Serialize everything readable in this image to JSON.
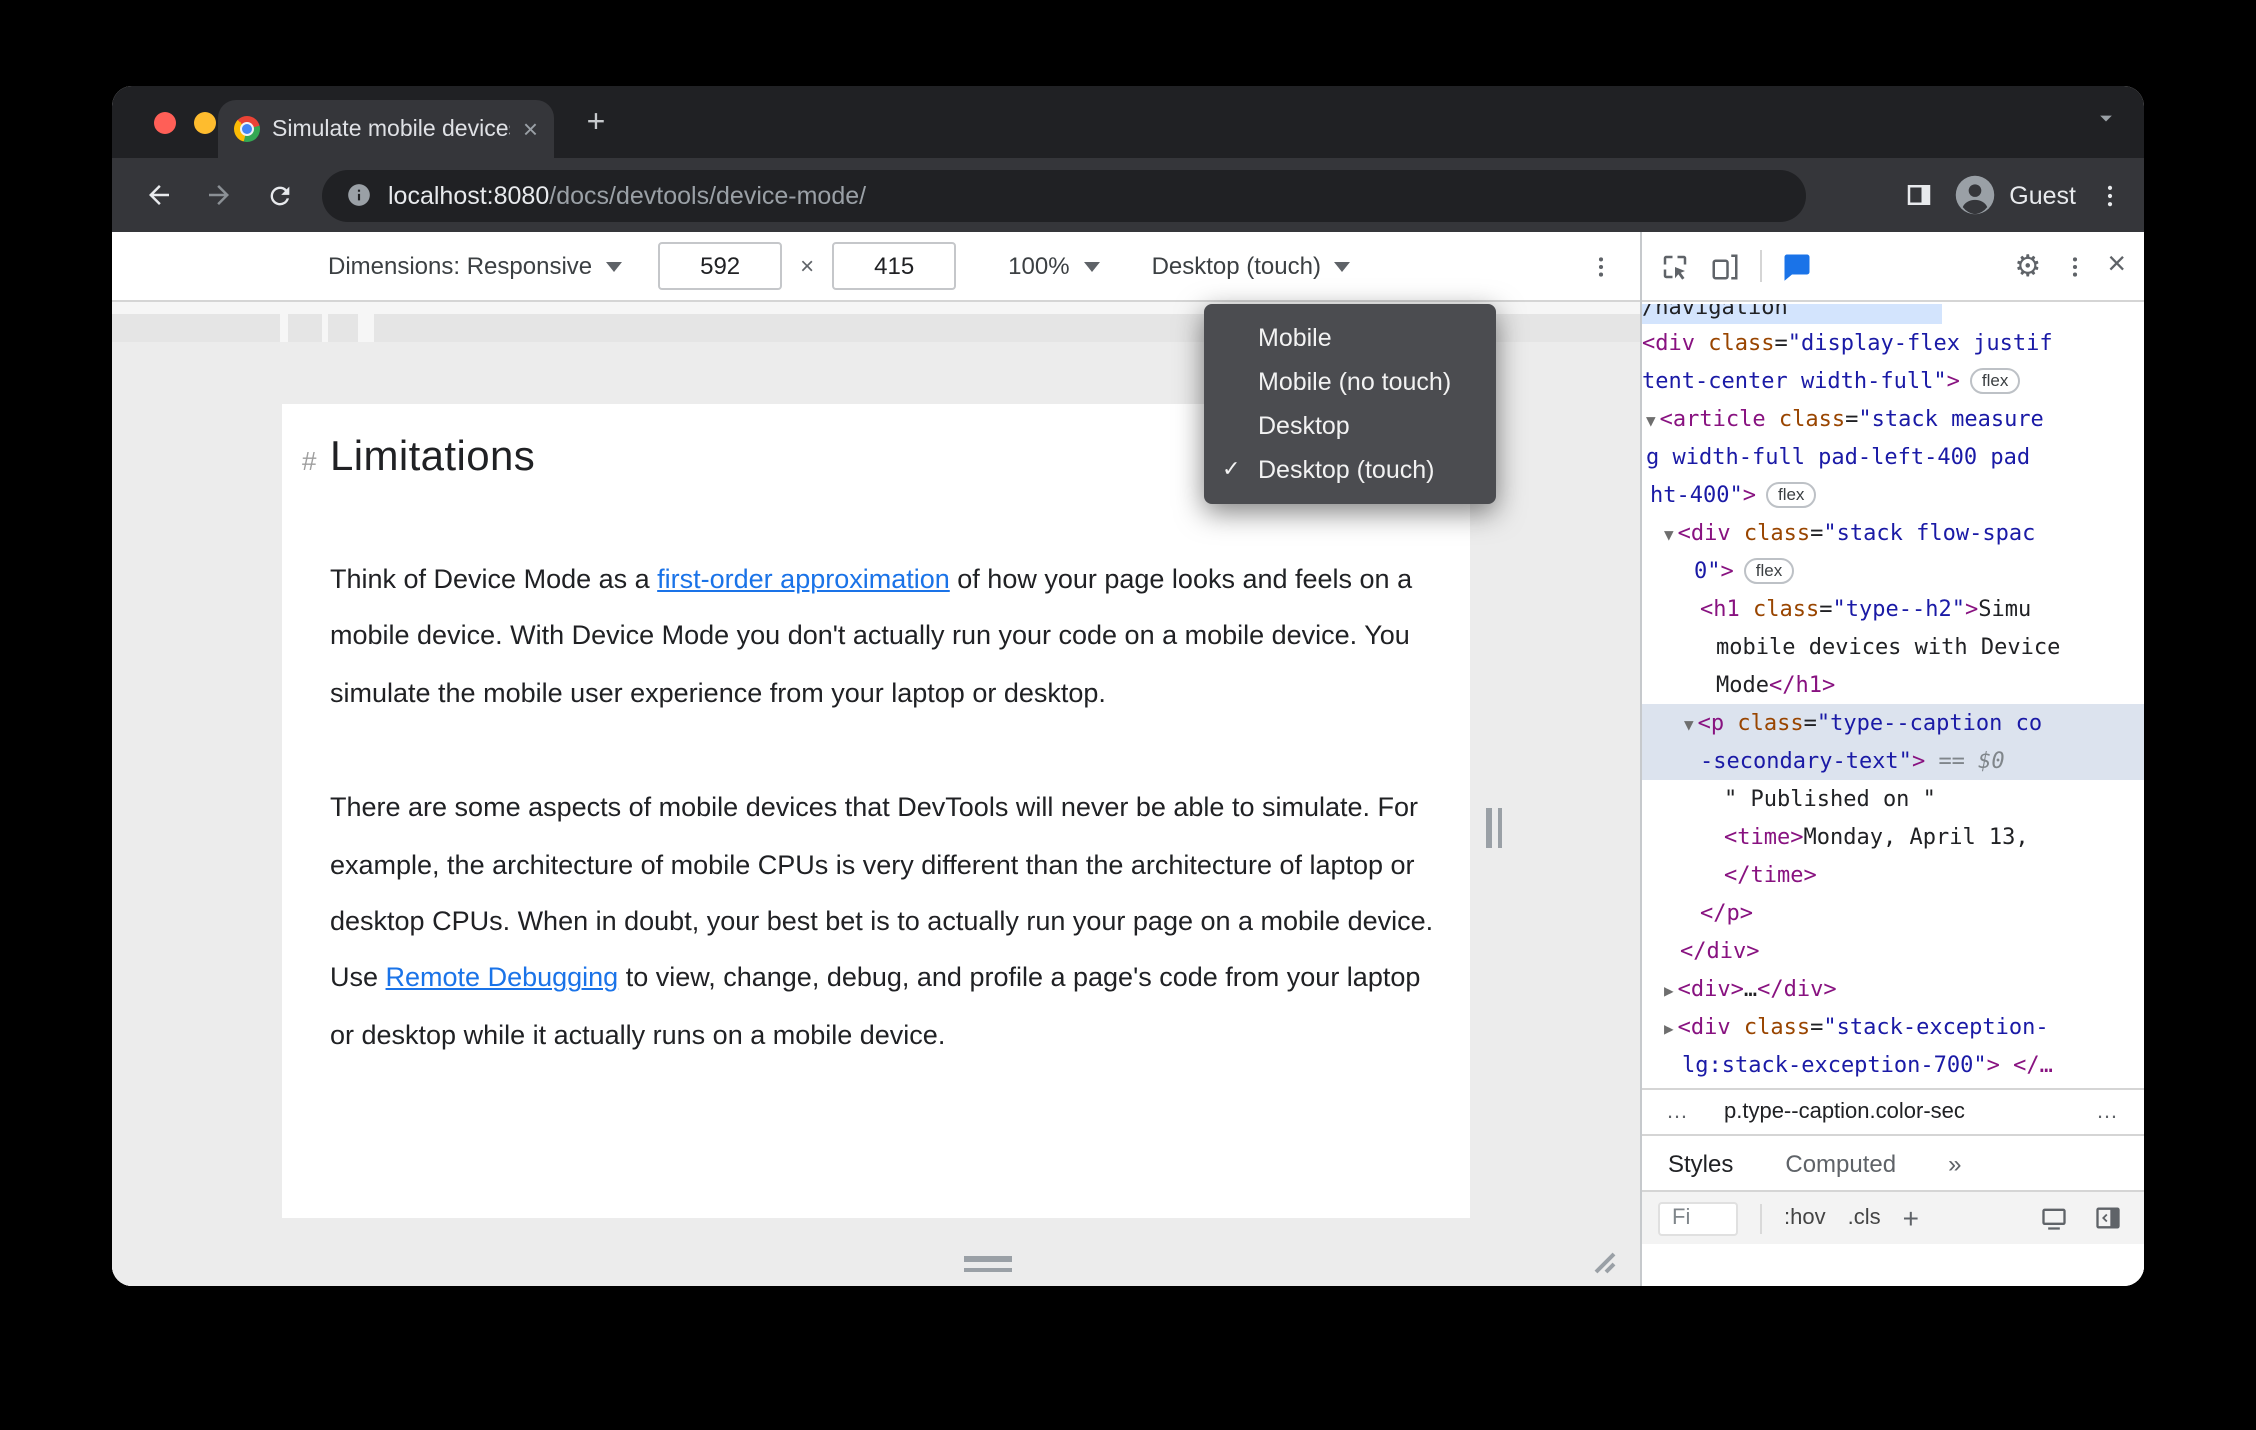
{
  "browser": {
    "tab_title": "Simulate mobile devices with D",
    "tab_close_glyph": "×",
    "new_tab_glyph": "+",
    "url_host": "localhost:8080",
    "url_path": "/docs/devtools/device-mode/",
    "profile_label": "Guest"
  },
  "device_toolbar": {
    "dimensions_label": "Dimensions: Responsive",
    "width_value": "592",
    "times_glyph": "×",
    "height_value": "415",
    "zoom_value": "100%",
    "device_type_value": "Desktop (touch)"
  },
  "device_type_menu": {
    "check_glyph": "✓",
    "items": [
      {
        "label": "Mobile",
        "checked": false
      },
      {
        "label": "Mobile (no touch)",
        "checked": false
      },
      {
        "label": "Desktop",
        "checked": false
      },
      {
        "label": "Desktop (touch)",
        "checked": true
      }
    ]
  },
  "page": {
    "heading_marker": "#",
    "heading": "Limitations",
    "para1_before": "Think of Device Mode as a ",
    "para1_link": "first-order approximation",
    "para1_after": " of how your page looks and feels on a mobile device. With Device Mode you don't actually run your code on a mobile device. You simulate the mobile user experience from your laptop or desktop.",
    "para2_before": "There are some aspects of mobile devices that DevTools will never be able to simulate. For example, the architecture of mobile CPUs is very different than the architecture of laptop or desktop CPUs. When in doubt, your best bet is to actually run your page on a mobile device. Use ",
    "para2_link": "Remote Debugging",
    "para2_after": " to view, change, debug, and profile a page's code from your laptop or desktop while it actually runs on a mobile device."
  },
  "devtools": {
    "dom_lines": [
      {
        "indent": 0,
        "hl": "hover",
        "partial": true,
        "tokens": [
          [
            "x",
            "/navigation"
          ]
        ]
      },
      {
        "indent": 0,
        "tokens": [
          [
            "t",
            "<div"
          ],
          [
            "x",
            " "
          ],
          [
            "at",
            "class"
          ],
          [
            "x",
            "="
          ],
          [
            "v",
            "\"display-flex justif"
          ]
        ]
      },
      {
        "indent": 0,
        "tokens": [
          [
            "v",
            "tent-center width-full\""
          ],
          [
            "t",
            ">"
          ],
          [
            "b",
            "flex"
          ]
        ]
      },
      {
        "indent": 2,
        "tokens": [
          [
            "a",
            "▼"
          ],
          [
            "t",
            "<article"
          ],
          [
            "x",
            " "
          ],
          [
            "at",
            "class"
          ],
          [
            "x",
            "="
          ],
          [
            "v",
            "\"stack measure"
          ]
        ]
      },
      {
        "indent": 2,
        "tokens": [
          [
            "v",
            "g width-full pad-left-400 pad"
          ]
        ]
      },
      {
        "indent": 4,
        "tokens": [
          [
            "v",
            "ht-400\""
          ],
          [
            "t",
            ">"
          ],
          [
            "b",
            "flex"
          ]
        ]
      },
      {
        "indent": 11,
        "tokens": [
          [
            "a",
            "▼"
          ],
          [
            "t",
            "<div"
          ],
          [
            "x",
            " "
          ],
          [
            "at",
            "class"
          ],
          [
            "x",
            "="
          ],
          [
            "v",
            "\"stack flow-spac"
          ]
        ]
      },
      {
        "indent": 26,
        "tokens": [
          [
            "v",
            "0\""
          ],
          [
            "t",
            ">"
          ],
          [
            "b",
            "flex"
          ]
        ]
      },
      {
        "indent": 29,
        "tokens": [
          [
            "t",
            "<h1"
          ],
          [
            "x",
            " "
          ],
          [
            "at",
            "class"
          ],
          [
            "x",
            "="
          ],
          [
            "v",
            "\"type--h2\""
          ],
          [
            "t",
            ">"
          ],
          [
            "x",
            "Simu"
          ]
        ]
      },
      {
        "indent": 37,
        "tokens": [
          [
            "x",
            "mobile devices with Device"
          ]
        ]
      },
      {
        "indent": 37,
        "tokens": [
          [
            "x",
            "Mode"
          ],
          [
            "t",
            "</h1>"
          ]
        ]
      },
      {
        "indent": 21,
        "hl": "sel",
        "tokens": [
          [
            "a",
            "▼"
          ],
          [
            "t",
            "<p"
          ],
          [
            "x",
            " "
          ],
          [
            "at",
            "class"
          ],
          [
            "x",
            "="
          ],
          [
            "v",
            "\"type--caption co"
          ]
        ]
      },
      {
        "indent": 29,
        "hl": "sel",
        "tokens": [
          [
            "v",
            "-secondary-text\""
          ],
          [
            "t",
            ">"
          ],
          [
            "x",
            " "
          ],
          [
            "g",
            "== $0"
          ]
        ]
      },
      {
        "indent": 41,
        "tokens": [
          [
            "x",
            "\" Published on \""
          ]
        ]
      },
      {
        "indent": 41,
        "tokens": [
          [
            "t",
            "<time>"
          ],
          [
            "x",
            "Monday, April 13,"
          ]
        ]
      },
      {
        "indent": 41,
        "tokens": [
          [
            "t",
            "</time>"
          ]
        ]
      },
      {
        "indent": 29,
        "tokens": [
          [
            "t",
            "</p>"
          ]
        ]
      },
      {
        "indent": 19,
        "tokens": [
          [
            "t",
            "</div>"
          ]
        ]
      },
      {
        "indent": 11,
        "tokens": [
          [
            "a",
            "▶"
          ],
          [
            "t",
            "<div>"
          ],
          [
            "x",
            "…"
          ],
          [
            "t",
            "</div>"
          ]
        ]
      },
      {
        "indent": 11,
        "tokens": [
          [
            "a",
            "▶"
          ],
          [
            "t",
            "<div"
          ],
          [
            "x",
            " "
          ],
          [
            "at",
            "class"
          ],
          [
            "x",
            "="
          ],
          [
            "v",
            "\"stack-exception-"
          ]
        ]
      },
      {
        "indent": 20,
        "tokens": [
          [
            "v",
            "lg:stack-exception-700\""
          ],
          [
            "t",
            ">"
          ],
          [
            "x",
            " "
          ],
          [
            "t",
            "</…"
          ]
        ]
      }
    ],
    "breadcrumb_more_left": "…",
    "breadcrumb_crumb": "p.type--caption.color-sec",
    "breadcrumb_more_right": "…",
    "tab_styles": "Styles",
    "tab_computed": "Computed",
    "more_tabs_glyph": "»",
    "filter_text": "Fi",
    "pseudo_button": ":hov",
    "class_button": ".cls",
    "new_rule_glyph": "+"
  },
  "colors": {
    "accent_blue": "#1a73e8",
    "code_tag": "#881280",
    "code_attr": "#994500",
    "code_value": "#1a1aa6"
  }
}
